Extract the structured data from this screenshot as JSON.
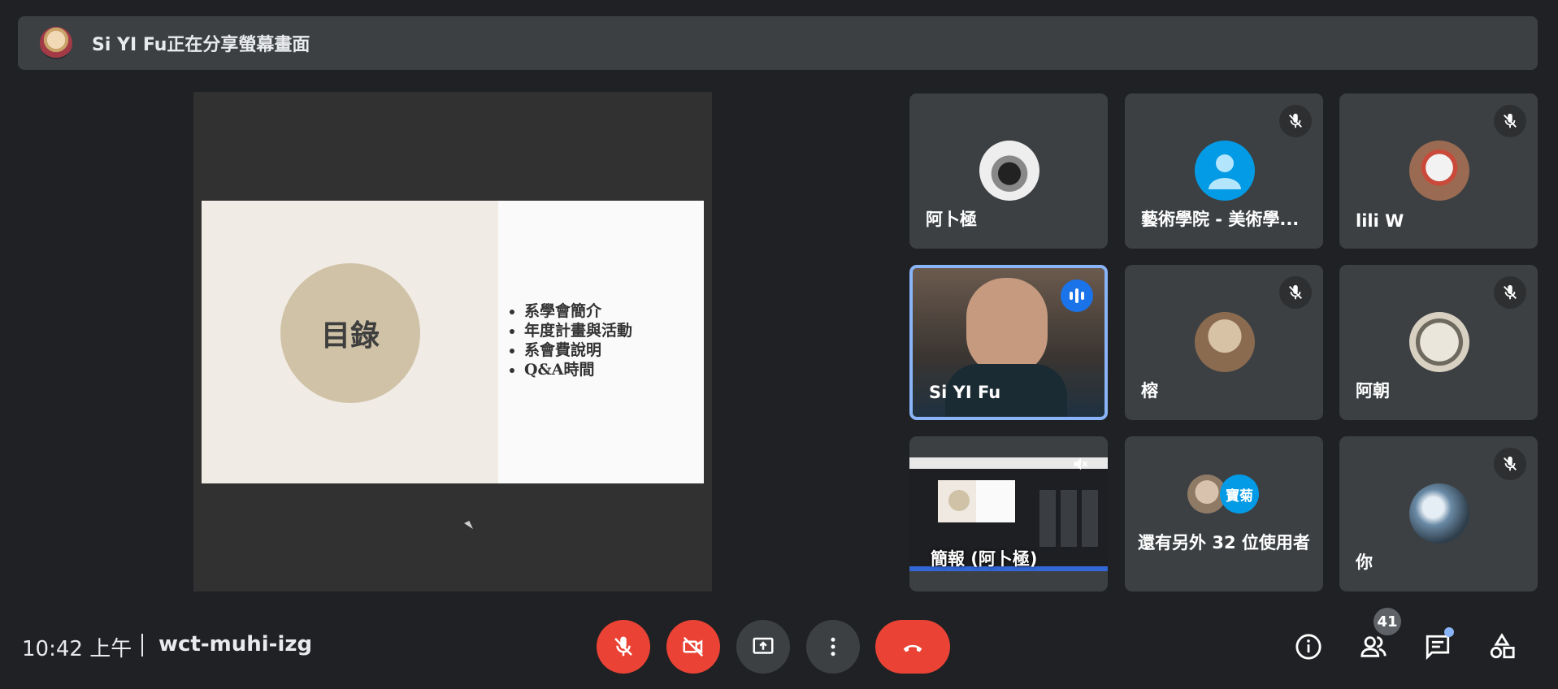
{
  "banner": {
    "text": "Si YI Fu正在分享螢幕畫面"
  },
  "slide": {
    "title": "目錄",
    "items": [
      "系學會簡介",
      "年度計畫與活動",
      "系會費說明",
      "Q&A時間"
    ]
  },
  "tiles": [
    {
      "name": "阿卜極",
      "muted": false
    },
    {
      "name": "藝術學院 - 美術學...",
      "muted": true
    },
    {
      "name": "lili W",
      "muted": true
    },
    {
      "name": "Si YI Fu",
      "speaking": true
    },
    {
      "name": "榕",
      "muted": true
    },
    {
      "name": "阿朝",
      "muted": true
    },
    {
      "name": "簡報 (阿卜極)",
      "audio_off": true
    },
    {
      "name": "還有另外 32 位使用者",
      "avatar_label": "寶菊"
    },
    {
      "name": "你",
      "muted": true
    }
  ],
  "bottom": {
    "time": "10:42 上午",
    "meeting_code": "wct-muhi-izg",
    "participants_count": "41"
  },
  "colors": {
    "red": "#ea4335",
    "blue": "#1a73e8",
    "tile": "#3c4043",
    "bg": "#202124"
  }
}
